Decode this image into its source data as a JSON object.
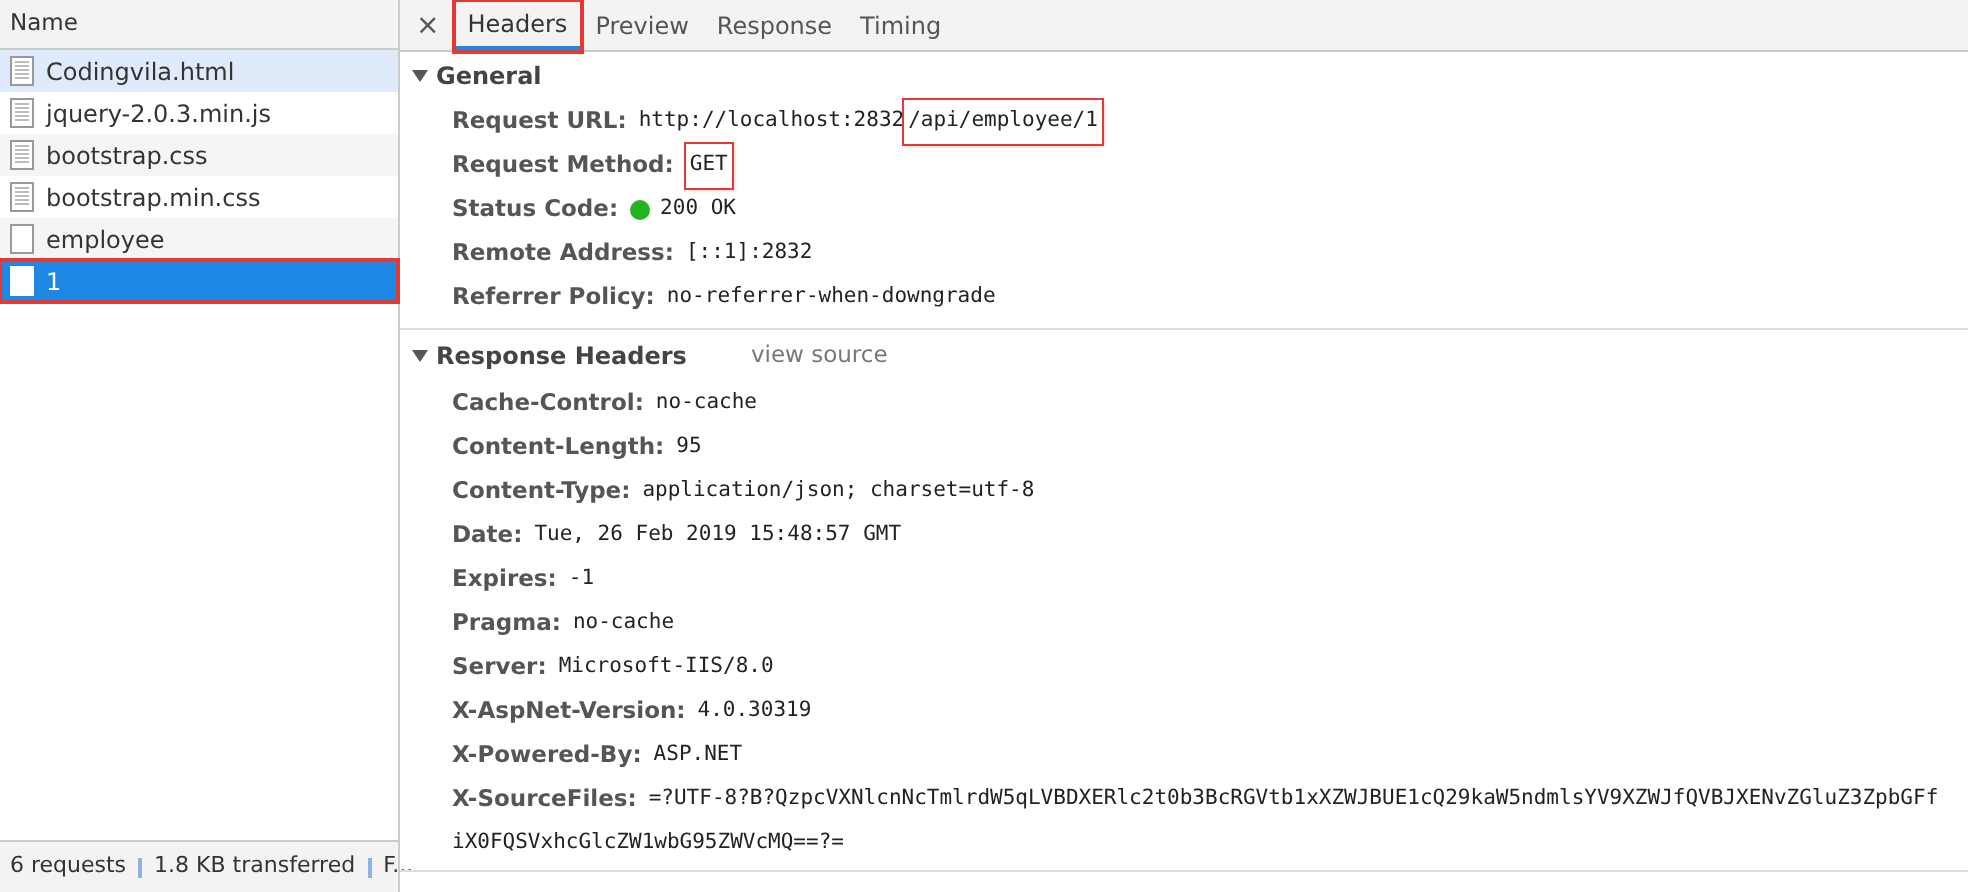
{
  "requests_panel": {
    "column_header": "Name",
    "rows": [
      {
        "name": "Codingvila.html",
        "kind": "document",
        "selected": false,
        "highlighted": false
      },
      {
        "name": "jquery-2.0.3.min.js",
        "kind": "document",
        "selected": false,
        "highlighted": false
      },
      {
        "name": "bootstrap.css",
        "kind": "document",
        "selected": false,
        "highlighted": false
      },
      {
        "name": "bootstrap.min.css",
        "kind": "document",
        "selected": false,
        "highlighted": false
      },
      {
        "name": "employee",
        "kind": "blank",
        "selected": false,
        "highlighted": false
      },
      {
        "name": "1",
        "kind": "blank",
        "selected": true,
        "highlighted": true
      }
    ],
    "status_bar": [
      "6 requests",
      "1.8 KB transferred",
      "F..."
    ]
  },
  "details": {
    "close": "×",
    "tabs": [
      {
        "label": "Headers",
        "selected": true,
        "highlighted": true
      },
      {
        "label": "Preview",
        "selected": false,
        "highlighted": false
      },
      {
        "label": "Response",
        "selected": false,
        "highlighted": false
      },
      {
        "label": "Timing",
        "selected": false,
        "highlighted": false
      }
    ],
    "general": {
      "title": "General",
      "expanded": true,
      "request_url": {
        "label": "Request URL:",
        "base": "http://localhost:2832",
        "path": "/api/employee/1",
        "path_highlighted": true
      },
      "request_method": {
        "label": "Request Method:",
        "value": "GET",
        "highlighted": true
      },
      "status_code": {
        "label": "Status Code:",
        "value": "200 OK",
        "color": "#22b322"
      },
      "remote_address": {
        "label": "Remote Address:",
        "value": "[::1]:2832"
      },
      "referrer_policy": {
        "label": "Referrer Policy:",
        "value": "no-referrer-when-downgrade"
      }
    },
    "response_headers": {
      "title": "Response Headers",
      "expanded": true,
      "link": "view source",
      "headers": [
        {
          "name": "Cache-Control:",
          "value": "no-cache"
        },
        {
          "name": "Content-Length:",
          "value": "95"
        },
        {
          "name": "Content-Type:",
          "value": "application/json; charset=utf-8"
        },
        {
          "name": "Date:",
          "value": "Tue, 26 Feb 2019 15:48:57 GMT"
        },
        {
          "name": "Expires:",
          "value": "-1"
        },
        {
          "name": "Pragma:",
          "value": "no-cache"
        },
        {
          "name": "Server:",
          "value": "Microsoft-IIS/8.0"
        },
        {
          "name": "X-AspNet-Version:",
          "value": "4.0.30319"
        },
        {
          "name": "X-Powered-By:",
          "value": "ASP.NET"
        },
        {
          "name": "X-SourceFiles:",
          "value": "=?UTF-8?B?QzpcVXNlcnNcTmlrdW5qLVBDXERlc2t0b3BcRGVtb1xXZWJBUE1cQ29kaW5ndmlsYV9XZWJfQVBJXENvZGluZ3ZpbGFf",
          "continuation": "iX0FQSVxhcGlcZW1wbG95ZWVcMQ==?="
        }
      ]
    }
  }
}
